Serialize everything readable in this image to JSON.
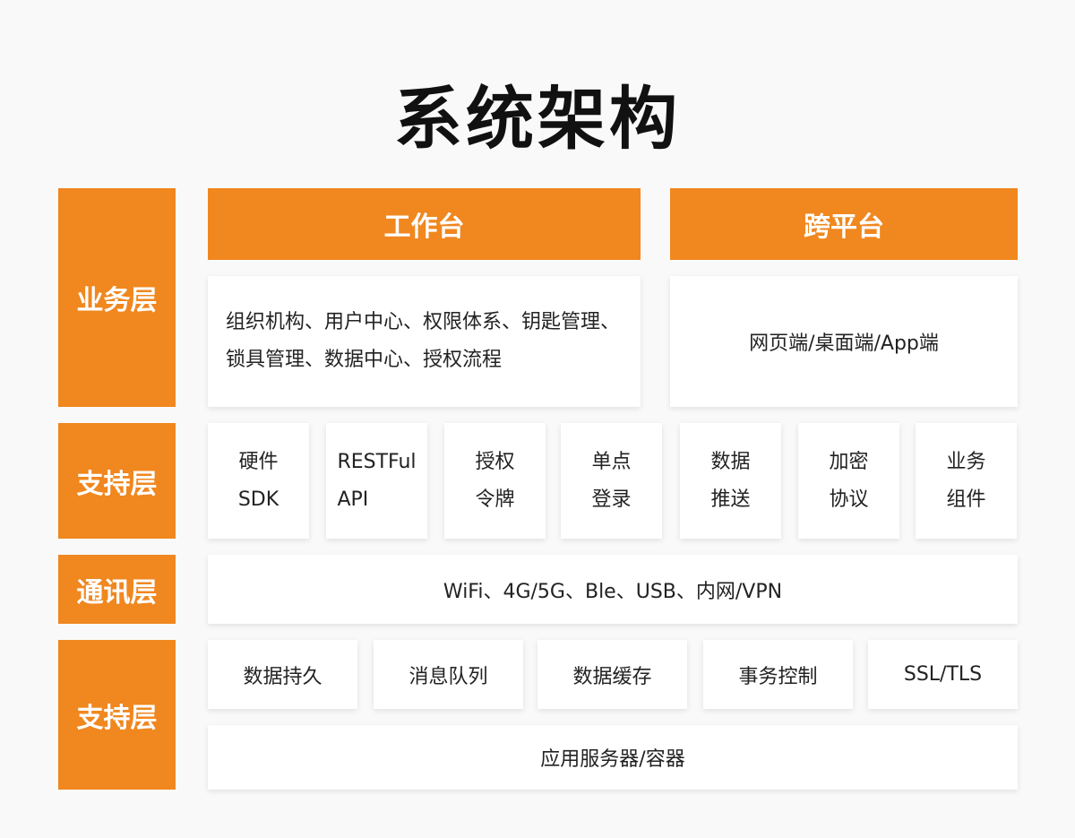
{
  "title": "系统架构",
  "layers": {
    "business": "业务层",
    "support1": "支持层",
    "comm": "通讯层",
    "support2": "支持层"
  },
  "business": {
    "workbench": {
      "header": "工作台",
      "line1": "组织机构、用户中心、权限体系、钥匙管理、",
      "line2": "锁具管理、数据中心、授权流程"
    },
    "crossplatform": {
      "header": "跨平台",
      "text": "网页端/桌面端/App端"
    }
  },
  "support1": {
    "items": [
      {
        "line1": "硬件",
        "line2": "SDK"
      },
      {
        "line1": "RESTFul",
        "line2": "API"
      },
      {
        "line1": "授权",
        "line2": "令牌"
      },
      {
        "line1": "单点",
        "line2": "登录"
      },
      {
        "line1": "数据",
        "line2": "推送"
      },
      {
        "line1": "加密",
        "line2": "协议"
      },
      {
        "line1": "业务",
        "line2": "组件"
      }
    ]
  },
  "comm": {
    "text": "WiFi、4G/5G、Ble、USB、内网/VPN"
  },
  "support2": {
    "items": [
      "数据持久",
      "消息队列",
      "数据缓存",
      "事务控制",
      "SSL/TLS"
    ],
    "server": "应用服务器/容器"
  },
  "colors": {
    "accent": "#f0871f",
    "background": "#f9f9f9",
    "card": "#ffffff"
  }
}
